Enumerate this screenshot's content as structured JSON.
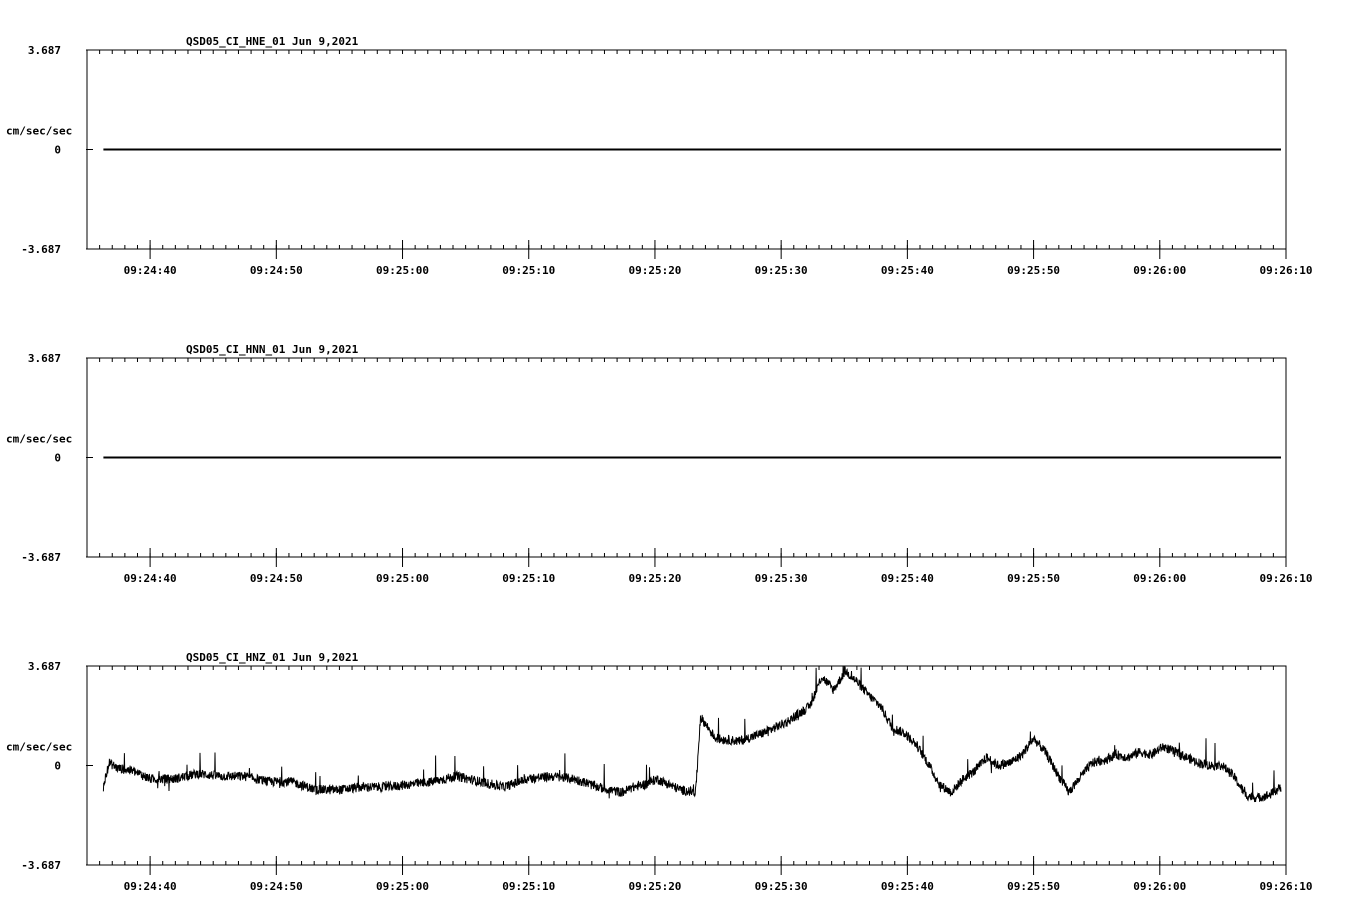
{
  "chart_data": [
    {
      "type": "line",
      "title": "QSD05_CI_HNE_01  Jun 9,2021",
      "ylabel": "cm/sec/sec",
      "ylim": [
        -3.687,
        3.687
      ],
      "yticks": [
        "3.687",
        "0",
        "-3.687"
      ],
      "xlim": [
        "09:24:35",
        "09:26:10"
      ],
      "xticks": [
        "09:24:40",
        "09:24:50",
        "09:25:00",
        "09:25:10",
        "09:25:20",
        "09:25:30",
        "09:25:40",
        "09:25:50",
        "09:26:00",
        "09:26:10"
      ],
      "x_start": "09:24:36.3",
      "x_end": "09:26:09.6",
      "y_shape": [
        [
          0,
          0
        ],
        [
          1,
          0
        ]
      ],
      "grid": false
    },
    {
      "type": "line",
      "title": "QSD05_CI_HNN_01  Jun 9,2021",
      "ylabel": "cm/sec/sec",
      "ylim": [
        -3.687,
        3.687
      ],
      "yticks": [
        "3.687",
        "0",
        "-3.687"
      ],
      "xlim": [
        "09:24:35",
        "09:26:10"
      ],
      "xticks": [
        "09:24:40",
        "09:24:50",
        "09:25:00",
        "09:25:10",
        "09:25:20",
        "09:25:30",
        "09:25:40",
        "09:25:50",
        "09:26:00",
        "09:26:10"
      ],
      "x_start": "09:24:36.3",
      "x_end": "09:26:09.6",
      "y_shape": [
        [
          0,
          0
        ],
        [
          1,
          0
        ]
      ],
      "grid": false
    },
    {
      "type": "line",
      "title": "QSD05_CI_HNZ_01  Jun 9,2021",
      "ylabel": "cm/sec/sec",
      "ylim": [
        -3.687,
        3.687
      ],
      "yticks": [
        "3.687",
        "0",
        "-3.687"
      ],
      "xlim": [
        "09:24:35",
        "09:26:10"
      ],
      "xticks": [
        "09:24:40",
        "09:24:50",
        "09:25:00",
        "09:25:10",
        "09:25:20",
        "09:25:30",
        "09:25:40",
        "09:25:50",
        "09:26:00",
        "09:26:10"
      ],
      "x_start": "09:24:36.3",
      "x_end": "09:26:09.6",
      "y_shape": [
        [
          0.0,
          -0.8
        ],
        [
          0.005,
          0.1
        ],
        [
          0.012,
          -0.1
        ],
        [
          0.025,
          -0.2
        ],
        [
          0.04,
          -0.5
        ],
        [
          0.06,
          -0.5
        ],
        [
          0.08,
          -0.3
        ],
        [
          0.1,
          -0.4
        ],
        [
          0.12,
          -0.4
        ],
        [
          0.14,
          -0.6
        ],
        [
          0.16,
          -0.6
        ],
        [
          0.18,
          -0.9
        ],
        [
          0.2,
          -0.9
        ],
        [
          0.22,
          -0.8
        ],
        [
          0.24,
          -0.8
        ],
        [
          0.26,
          -0.7
        ],
        [
          0.28,
          -0.6
        ],
        [
          0.3,
          -0.4
        ],
        [
          0.32,
          -0.6
        ],
        [
          0.34,
          -0.8
        ],
        [
          0.36,
          -0.5
        ],
        [
          0.38,
          -0.4
        ],
        [
          0.4,
          -0.5
        ],
        [
          0.42,
          -0.8
        ],
        [
          0.44,
          -1.0
        ],
        [
          0.45,
          -0.8
        ],
        [
          0.46,
          -0.7
        ],
        [
          0.47,
          -0.5
        ],
        [
          0.48,
          -0.7
        ],
        [
          0.49,
          -0.9
        ],
        [
          0.503,
          -1.0
        ],
        [
          0.504,
          -0.3
        ],
        [
          0.507,
          1.8
        ],
        [
          0.52,
          1.0
        ],
        [
          0.54,
          0.9
        ],
        [
          0.56,
          1.2
        ],
        [
          0.58,
          1.6
        ],
        [
          0.6,
          2.2
        ],
        [
          0.61,
          3.3
        ],
        [
          0.62,
          2.8
        ],
        [
          0.63,
          3.5
        ],
        [
          0.64,
          3.1
        ],
        [
          0.65,
          2.6
        ],
        [
          0.66,
          2.2
        ],
        [
          0.67,
          1.4
        ],
        [
          0.68,
          1.2
        ],
        [
          0.69,
          0.8
        ],
        [
          0.7,
          0.1
        ],
        [
          0.71,
          -0.7
        ],
        [
          0.72,
          -1.0
        ],
        [
          0.73,
          -0.5
        ],
        [
          0.74,
          -0.2
        ],
        [
          0.75,
          0.3
        ],
        [
          0.76,
          0.0
        ],
        [
          0.77,
          0.1
        ],
        [
          0.78,
          0.4
        ],
        [
          0.79,
          1.0
        ],
        [
          0.8,
          0.5
        ],
        [
          0.81,
          -0.3
        ],
        [
          0.82,
          -1.0
        ],
        [
          0.83,
          -0.4
        ],
        [
          0.84,
          0.1
        ],
        [
          0.85,
          0.2
        ],
        [
          0.86,
          0.4
        ],
        [
          0.87,
          0.3
        ],
        [
          0.88,
          0.5
        ],
        [
          0.89,
          0.4
        ],
        [
          0.9,
          0.7
        ],
        [
          0.91,
          0.5
        ],
        [
          0.92,
          0.3
        ],
        [
          0.93,
          0.1
        ],
        [
          0.94,
          0.0
        ],
        [
          0.95,
          0.0
        ],
        [
          0.96,
          -0.4
        ],
        [
          0.97,
          -1.1
        ],
        [
          0.98,
          -1.2
        ],
        [
          0.99,
          -1.1
        ],
        [
          1.0,
          -0.8
        ]
      ],
      "grid": false
    }
  ]
}
